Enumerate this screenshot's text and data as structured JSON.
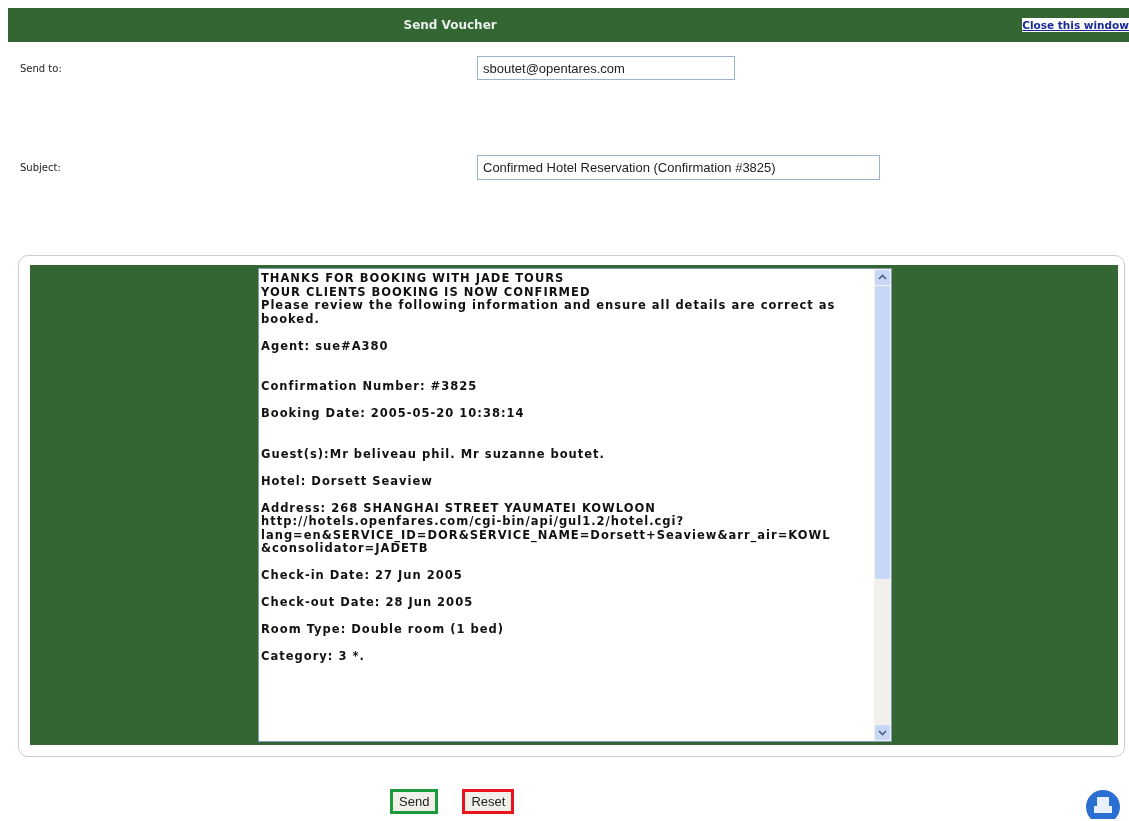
{
  "header": {
    "title": "Send Voucher",
    "close_link": "Close this window"
  },
  "fields": [
    {
      "label": "Send to:",
      "value": "sboutet@opentares.com"
    },
    {
      "label": "Subject:",
      "value": "Confirmed Hotel Reservation (Confirmation #3825)"
    }
  ],
  "message": {
    "paragraphs": [
      {
        "spaced": false,
        "lines": [
          "THANKS FOR BOOKING WITH JADE TOURS",
          "YOUR CLIENTS BOOKING IS NOW CONFIRMED",
          "Please review the following information and ensure all details are correct as",
          "booked."
        ]
      },
      {
        "spaced": false,
        "lines": [
          "Agent: sue#A380"
        ]
      },
      {
        "spaced": true,
        "lines": [
          "Confirmation Number: #3825"
        ]
      },
      {
        "spaced": false,
        "lines": [
          "Booking Date: 2005-05-20 10:38:14"
        ]
      },
      {
        "spaced": true,
        "lines": [
          "Guest(s):Mr beliveau phil. Mr suzanne boutet."
        ]
      },
      {
        "spaced": false,
        "lines": [
          "Hotel: Dorsett Seaview"
        ]
      },
      {
        "spaced": false,
        "lines": [
          "Address: 268 SHANGHAI STREET YAUMATEI KOWLOON",
          "http://hotels.openfares.com/cgi-bin/api/gul1.2/hotel.cgi?",
          "lang=en&SERVICE_ID=DOR&SERVICE_NAME=Dorsett+Seaview&arr_air=KOWL",
          "&consolidator=JADETB"
        ]
      },
      {
        "spaced": false,
        "lines": [
          "Check-in Date: 27 Jun 2005"
        ]
      },
      {
        "spaced": false,
        "lines": [
          "Check-out Date: 28 Jun 2005"
        ]
      },
      {
        "spaced": false,
        "lines": [
          "Room Type: Double room (1 bed)"
        ]
      },
      {
        "spaced": false,
        "lines": [
          "Category: 3 *."
        ]
      }
    ]
  },
  "buttons": [
    {
      "label": "Send",
      "color": "#1a9a3a"
    },
    {
      "label": "Reset",
      "color": "#e8141e"
    }
  ]
}
